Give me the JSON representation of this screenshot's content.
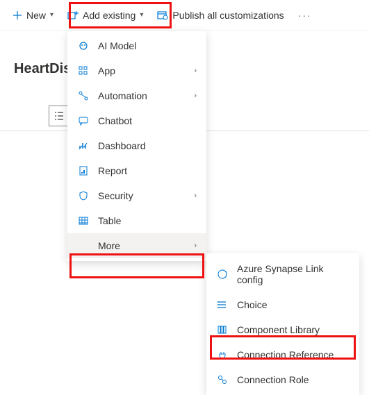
{
  "toolbar": {
    "new_label": "New",
    "add_existing_label": "Add existing",
    "publish_label": "Publish all customizations"
  },
  "page": {
    "title_visible": "HeartDise"
  },
  "menu": {
    "items": [
      {
        "label": "AI Model",
        "has_submenu": false
      },
      {
        "label": "App",
        "has_submenu": true
      },
      {
        "label": "Automation",
        "has_submenu": true
      },
      {
        "label": "Chatbot",
        "has_submenu": false
      },
      {
        "label": "Dashboard",
        "has_submenu": false
      },
      {
        "label": "Report",
        "has_submenu": false
      },
      {
        "label": "Security",
        "has_submenu": true
      },
      {
        "label": "Table",
        "has_submenu": false
      },
      {
        "label": "More",
        "has_submenu": true
      }
    ]
  },
  "submenu": {
    "items": [
      {
        "label": "Azure Synapse Link config"
      },
      {
        "label": "Choice"
      },
      {
        "label": "Component Library"
      },
      {
        "label": "Connection Reference"
      },
      {
        "label": "Connection Role"
      }
    ]
  }
}
